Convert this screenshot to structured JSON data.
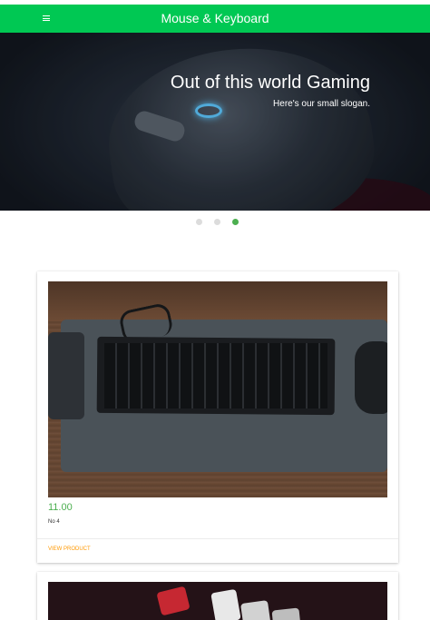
{
  "appbar": {
    "title": "Mouse & Keyboard",
    "menu_icon": "hamburger-menu-icon",
    "color": "#00c853"
  },
  "hero": {
    "title": "Out of this world Gaming",
    "subtitle": "Here's our small slogan.",
    "slide_count": 3,
    "active_slide": 3
  },
  "products": [
    {
      "price": "11.00",
      "name": "No 4",
      "action_label": "VIEW PRODUCT"
    }
  ],
  "colors": {
    "accent": "#4caf50",
    "link": "#ff9800"
  }
}
